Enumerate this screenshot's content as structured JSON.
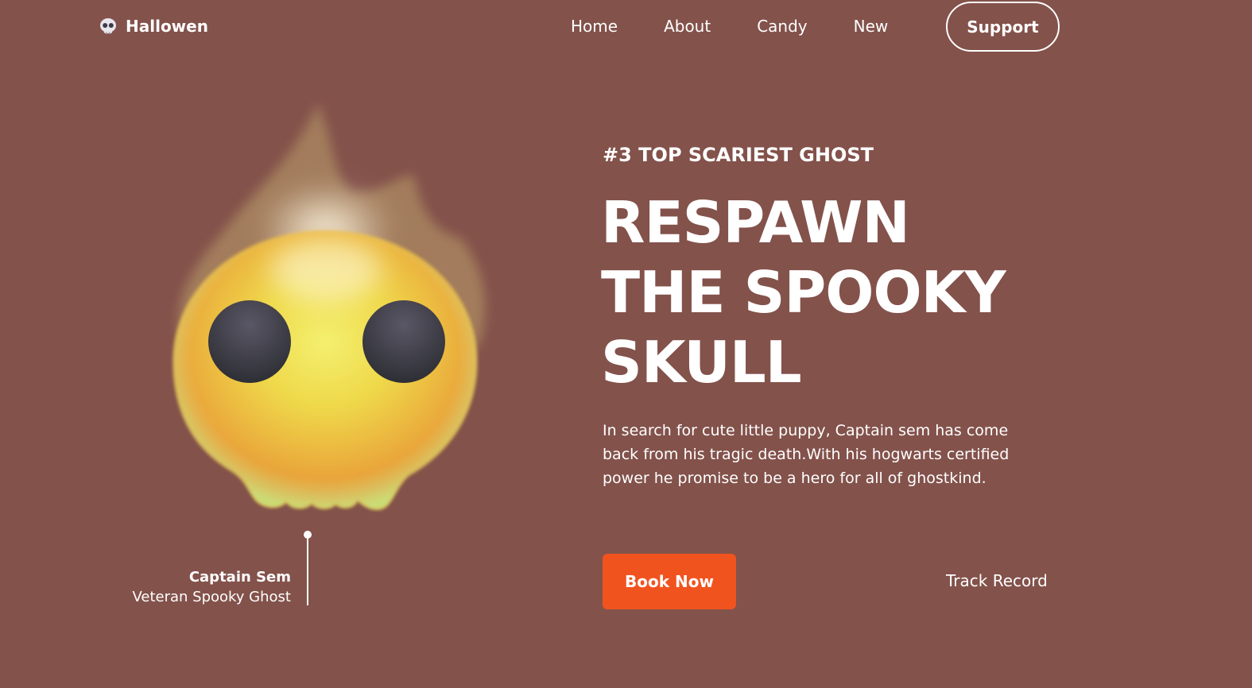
{
  "header": {
    "brand_name": "Hallowen",
    "brand_icon": "skull-icon",
    "nav": [
      {
        "label": "Home"
      },
      {
        "label": "About"
      },
      {
        "label": "Candy"
      },
      {
        "label": "New"
      }
    ],
    "support_label": "Support"
  },
  "hero": {
    "kicker": "#3 TOP SCARIEST GHOST",
    "headline_lines": [
      "RESPAWN",
      "THE SPOOKY",
      "SKULL"
    ],
    "description": "In search for cute little puppy, Captain sem has come back from his tragic death.With his hogwarts certified power he promise to be a hero for all of ghostkind.",
    "book_label": "Book Now",
    "track_label": "Track Record"
  },
  "character": {
    "name": "Captain Sem",
    "role": "Veteran Spooky Ghost"
  },
  "colors": {
    "background": "#83524b",
    "accent": "#f1531f",
    "text": "#ffffff"
  }
}
